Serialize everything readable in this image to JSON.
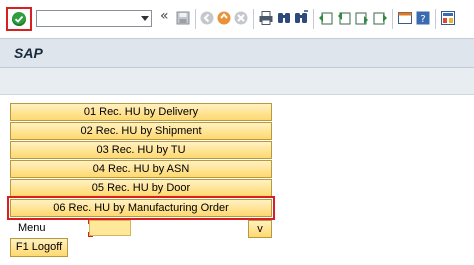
{
  "toolbar": {
    "command_field_value": "",
    "icons": [
      "enter-icon",
      "dropdown-icon",
      "back-icon",
      "save-icon",
      "exit-icon",
      "cancel-icon",
      "stop-icon",
      "print-icon",
      "find-icon",
      "find-next-icon",
      "first-page-icon",
      "prev-page-icon",
      "next-page-icon",
      "last-page-icon",
      "create-session-icon",
      "help-icon",
      "layout-icon"
    ],
    "back_glyph": "«"
  },
  "title": "SAP",
  "menu": {
    "items": [
      {
        "label": "01 Rec. HU by Delivery"
      },
      {
        "label": "02 Rec. HU by Shipment"
      },
      {
        "label": "03 Rec. HU by TU"
      },
      {
        "label": "04 Rec. HU by ASN"
      },
      {
        "label": "05 Rec. HU by Door"
      },
      {
        "label": "06 Rec. HU by Manufacturing Order"
      }
    ],
    "selected_index": 5,
    "menu_label": "Menu",
    "menu_value": "",
    "v_label": "v",
    "logoff_label": "F1 Logoff"
  },
  "colors": {
    "highlight": "#d92020",
    "button_fill": "#ffd970",
    "header_bg": "#dfe5ec",
    "enter_green": "#2e9e3e"
  }
}
